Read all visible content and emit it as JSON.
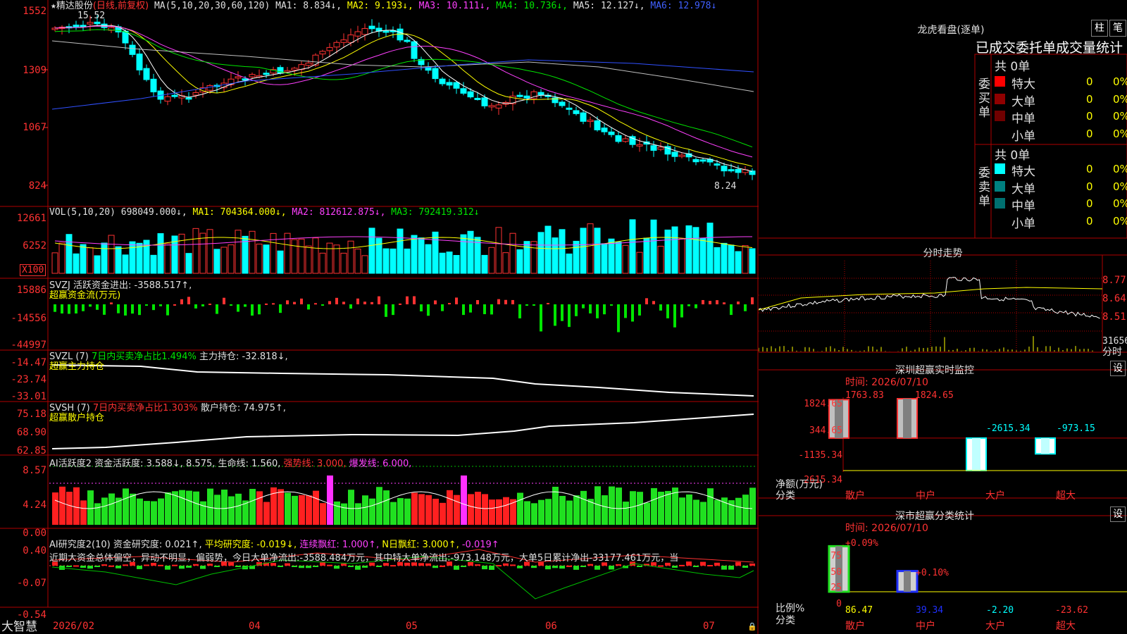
{
  "kline": {
    "stock_name": "精达股份",
    "period": "(日线,前复权)",
    "ma_prefix": "MA(5,10,20,30,60,120)",
    "ma1": "MA1: 8.834↓,",
    "ma2": "MA2: 9.193↓,",
    "ma3": "MA3: 10.111↓,",
    "ma4": "MA4: 10.736↓,",
    "ma5": "MA5: 12.127↓,",
    "ma6": "MA6: 12.978↓",
    "y_ticks": [
      "1552",
      "1309",
      "1067",
      "824"
    ],
    "high_label": "15.52",
    "low_label": "8.24",
    "star": "★"
  },
  "volume": {
    "header": "VOL(5,10,20)",
    "value": "698049.000↓,",
    "ma1": "MA1: 704364.000↓,",
    "ma2": "MA2: 812612.875↓,",
    "ma3": "MA3: 792419.312↓",
    "y_ticks": [
      "12661",
      "6252"
    ],
    "unit": "X100"
  },
  "svzj": {
    "header": "SVZJ  活跃资金进出: -3588.517↑,",
    "subtitle": "超赢资金流(万元)",
    "y_ticks": [
      "15886",
      "-14556",
      "-44997"
    ]
  },
  "svzl": {
    "prefix": "SVZL (7)",
    "ratio": "7日内买卖净占比1.494%",
    "main": "主力持仓: -32.818↓,",
    "subtitle": "超赢主力持仓",
    "y_ticks": [
      "-14.47",
      "-23.74",
      "-33.01"
    ]
  },
  "svsh": {
    "prefix": "SVSH (7)",
    "ratio": "7日内买卖净占比1.303%",
    "main": "散户持仓: 74.975↑,",
    "subtitle": "超赢散户持仓",
    "y_ticks": [
      "75.18",
      "68.90",
      "62.85"
    ]
  },
  "ai_active": {
    "prefix": "AI活跃度2",
    "act": "资金活跃度: 3.588↓, 8.575,",
    "life": "生命线: 1.560,",
    "strong": "强势线: 3.000,",
    "burst": "爆发线: 6.000,",
    "y_ticks": [
      "8.57",
      "4.24",
      "0.00"
    ]
  },
  "ai_research": {
    "prefix": "AI研究度2(10)",
    "res": "资金研究度: 0.021↑,",
    "avg": "平均研究度: -0.019↓,",
    "red": "连续飘红: 1.000↑,",
    "nday": "N日飘红: 3.000↑,",
    "tail": "-0.019↑",
    "comment": "近期大资金总体偏空，异动不明显，偏弱势，今日大单净流出:-3588.484万元，其中特大单净流出:-973.148万元，大单5日累计净出-33177.461万元，当",
    "y_ticks": [
      "0.40",
      "-0.07",
      "-0.54"
    ]
  },
  "bottom": {
    "brand": "大智慧",
    "dates": [
      "2026/02",
      "04",
      "05",
      "06",
      "07"
    ]
  },
  "longhu": {
    "title": "龙虎看盘(逐单)",
    "btn_zhu": "柱",
    "btn_bi": "笔",
    "subtitle": "已成交委托单成交量统计",
    "buy_label": "委买单",
    "sell_label": "委卖单",
    "buy_total": "共 0单",
    "sell_total": "共 0单",
    "buy_rows": [
      {
        "name": "特大",
        "count": "0",
        "pct": "0%",
        "color": "#ff0000"
      },
      {
        "name": "大单",
        "count": "0",
        "pct": "0%",
        "color": "#900000"
      },
      {
        "name": "中单",
        "count": "0",
        "pct": "0%",
        "color": "#700000"
      },
      {
        "name": "小单",
        "count": "0",
        "pct": "0%",
        "color": "#000000"
      }
    ],
    "sell_rows": [
      {
        "name": "特大",
        "count": "0",
        "pct": "0%",
        "color": "#00ffff"
      },
      {
        "name": "大单",
        "count": "0",
        "pct": "0%",
        "color": "#008080"
      },
      {
        "name": "中单",
        "count": "0",
        "pct": "0%",
        "color": "#007070"
      },
      {
        "name": "小单",
        "count": "0",
        "pct": "0%",
        "color": "#000000"
      }
    ]
  },
  "intraday": {
    "title": "分时走势",
    "price_ticks": [
      "8.77",
      "8.64",
      "8.51"
    ],
    "vol_tick": "31656",
    "unit": "分时"
  },
  "sz_monitor": {
    "title": "深圳超赢实时监控",
    "btn": "设",
    "time": "时间: 2026/07/10",
    "y_ticks": [
      "1824.65",
      "344.65",
      "-1135.34",
      "-2615.34"
    ],
    "unit": "净额(万元)",
    "cat_label": "分类",
    "categories": [
      "散户",
      "中户",
      "大户",
      "超大"
    ],
    "values": [
      1763.83,
      1824.65,
      -2615.34,
      -973.15
    ],
    "value_labels": [
      "1763.83",
      "1824.65",
      "-2615.34",
      "-973.15"
    ]
  },
  "sz_class": {
    "title": "深市超赢分类统计",
    "btn": "设",
    "time": "时间: 2026/07/10",
    "y_ticks": [
      "75",
      "50",
      "25",
      "0"
    ],
    "unit": "比例%",
    "cat_label": "分类",
    "categories": [
      "散户",
      "中户",
      "大户",
      "超大"
    ],
    "values": [
      86.47,
      39.34,
      -2.2,
      -23.62
    ],
    "value_labels": [
      "86.47",
      "39.34",
      "-2.20",
      "-23.62"
    ],
    "changes": [
      "+0.09%",
      "+0.10%"
    ]
  },
  "chart_data": [
    {
      "type": "bar",
      "title": "深圳超赢实时监控",
      "categories": [
        "散户",
        "中户",
        "大户",
        "超大"
      ],
      "values": [
        1763.83,
        1824.65,
        -2615.34,
        -973.15
      ],
      "ylabel": "净额(万元)",
      "ylim": [
        -2615.34,
        1824.65
      ]
    },
    {
      "type": "bar",
      "title": "深市超赢分类统计",
      "categories": [
        "散户",
        "中户",
        "大户",
        "超大"
      ],
      "values": [
        86.47,
        39.34,
        -2.2,
        -23.62
      ],
      "ylabel": "比例%",
      "ylim": [
        0,
        100
      ]
    }
  ]
}
